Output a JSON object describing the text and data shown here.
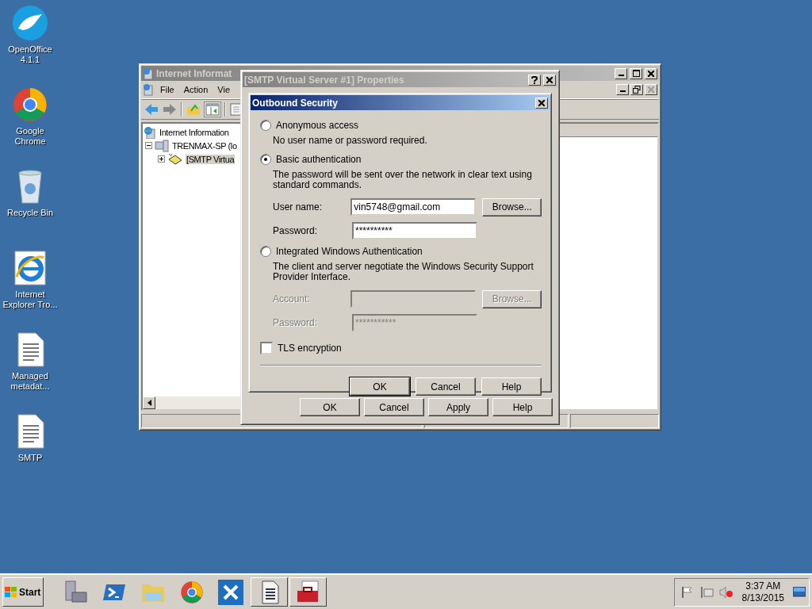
{
  "desktop_icons": [
    {
      "label": "OpenOffice 4.1.1",
      "kind": "openoffice"
    },
    {
      "label": "Google Chrome",
      "kind": "chrome"
    },
    {
      "label": "Recycle Bin",
      "kind": "recycle"
    },
    {
      "label": "Internet Explorer Tro...",
      "kind": "ie"
    },
    {
      "label": "Managed metadat...",
      "kind": "document"
    },
    {
      "label": "SMTP",
      "kind": "document"
    }
  ],
  "iis_window": {
    "title": "Internet Informat",
    "menu": [
      "File",
      "Action",
      "Vie"
    ],
    "tree": [
      {
        "label": "Internet Information",
        "kind": "root",
        "selected": false,
        "children": [
          {
            "label": "TRENMAX-SP (lo",
            "kind": "server",
            "selected": false,
            "expanded": true,
            "children": [
              {
                "label": "[SMTP Virtua",
                "kind": "smtp",
                "selected": true,
                "expanded": false
              }
            ]
          }
        ]
      }
    ]
  },
  "properties_dialog": {
    "title": "[SMTP Virtual Server #1] Properties",
    "active": false,
    "buttons": [
      "OK",
      "Cancel",
      "Apply",
      "Help"
    ]
  },
  "outbound_dialog": {
    "title": "Outbound Security",
    "active": true,
    "options": [
      {
        "label": "Anonymous access",
        "selected": false,
        "description": "No user name or password required."
      },
      {
        "label": "Basic authentication",
        "selected": true,
        "description": "The password will be sent over the network in clear text using standard commands.",
        "fields": [
          {
            "label": "User name:",
            "value": "vin5748@gmail.com",
            "disabled": false,
            "button": "Browse..."
          },
          {
            "label": "Password:",
            "value": "**********",
            "disabled": false
          }
        ]
      },
      {
        "label": "Integrated Windows Authentication",
        "selected": false,
        "description": "The client and server negotiate the Windows Security Support Provider Interface.",
        "fields": [
          {
            "label": "Account:",
            "disabled": true,
            "button": "Browse..."
          },
          {
            "label": "Password:",
            "value": "***********",
            "disabled": true
          }
        ]
      }
    ],
    "tls": {
      "label": "TLS encryption",
      "checked": false
    },
    "buttons": [
      {
        "label": "OK",
        "default": true
      },
      {
        "label": "Cancel",
        "default": false
      },
      {
        "label": "Help",
        "default": false
      }
    ]
  },
  "taskbar": {
    "start": "Start",
    "apps": [
      {
        "kind": "server-manager",
        "open": false
      },
      {
        "kind": "powershell",
        "open": false
      },
      {
        "kind": "folder",
        "open": false
      },
      {
        "kind": "chrome",
        "open": false
      },
      {
        "kind": "tools",
        "open": false
      },
      {
        "kind": "document",
        "open": true
      },
      {
        "kind": "toolbox",
        "open": true
      }
    ],
    "time": "3:37 AM",
    "date": "8/13/2015"
  }
}
